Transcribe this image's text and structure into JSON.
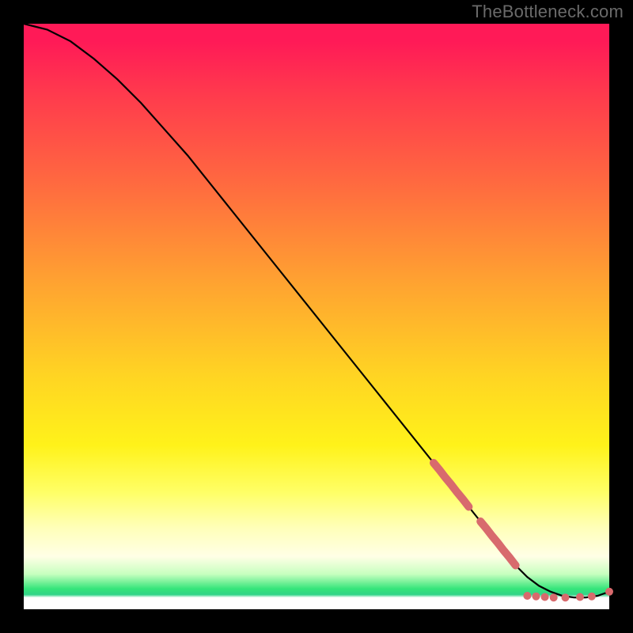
{
  "watermark": "TheBottleneck.com",
  "colors": {
    "marker": "#d86a6d",
    "curve": "#000000"
  },
  "chart_data": {
    "type": "line",
    "title": "",
    "xlabel": "",
    "ylabel": "",
    "xlim": [
      0,
      100
    ],
    "ylim": [
      0,
      100
    ],
    "grid": false,
    "legend": false,
    "series": [
      {
        "name": "bottleneck-curve",
        "x": [
          0,
          4,
          8,
          12,
          16,
          20,
          24,
          28,
          32,
          36,
          40,
          44,
          48,
          52,
          56,
          60,
          64,
          68,
          72,
          76,
          80,
          84,
          86,
          88,
          90,
          92,
          94,
          96,
          98,
          100
        ],
        "y": [
          100,
          99,
          97,
          94,
          90.5,
          86.5,
          82,
          77.5,
          72.5,
          67.5,
          62.5,
          57.5,
          52.5,
          47.5,
          42.5,
          37.5,
          32.5,
          27.5,
          22.5,
          17.5,
          12.5,
          7.5,
          5.5,
          4,
          3,
          2.3,
          2,
          2,
          2.3,
          3
        ]
      }
    ],
    "highlighted_points": {
      "name": "highlighted-range",
      "clusters": [
        {
          "x": [
            70,
            71,
            72,
            73,
            74,
            75,
            76
          ],
          "y": [
            25,
            23.8,
            22.5,
            21.3,
            20,
            18.8,
            17.5
          ]
        },
        {
          "x": [
            78,
            79,
            80,
            81,
            82,
            83,
            84
          ],
          "y": [
            15,
            13.8,
            12.5,
            11.3,
            10,
            8.8,
            7.5
          ]
        }
      ],
      "flat_points": [
        {
          "x": 86,
          "y": 2.3
        },
        {
          "x": 87.5,
          "y": 2.2
        },
        {
          "x": 89,
          "y": 2.1
        },
        {
          "x": 90.5,
          "y": 2.0
        },
        {
          "x": 92.5,
          "y": 2.0
        },
        {
          "x": 95,
          "y": 2.1
        },
        {
          "x": 97,
          "y": 2.2
        },
        {
          "x": 100,
          "y": 3.0
        }
      ]
    }
  }
}
